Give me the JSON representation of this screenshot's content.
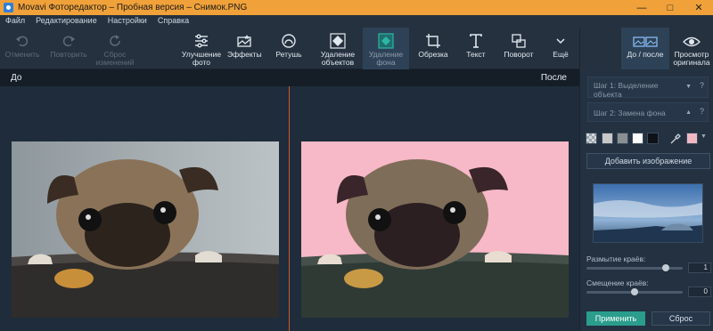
{
  "window": {
    "title": "Movavi Фоторедактор – Пробная версия – Снимок.PNG"
  },
  "menu": [
    "Файл",
    "Редактирование",
    "Настройки",
    "Справка"
  ],
  "toolbar": {
    "undo": "Отменить",
    "redo": "Повторить",
    "reset_changes": "Сброс изменений",
    "enhance": "Улучшение фото",
    "effects": "Эффекты",
    "retouch": "Ретушь",
    "remove_objects": "Удаление объектов",
    "remove_background": "Удаление фона",
    "crop": "Обрезка",
    "text": "Текст",
    "rotate": "Поворот",
    "more": "Ещё"
  },
  "view": {
    "before_after": "До / после",
    "view_original": "Просмотр оригинала"
  },
  "compare": {
    "before": "До",
    "after": "После"
  },
  "panel": {
    "step1": "Шаг 1: Выделение объекта",
    "step2": "Шаг 2: Замена фона",
    "help": "?",
    "add_image": "Добавить изображение",
    "edge_blur_label": "Размытие краёв:",
    "edge_blur_value": "1",
    "edge_blur_level": 0.85,
    "edge_shift_label": "Смещение краёв:",
    "edge_shift_value": "0",
    "edge_shift_level": 0.5,
    "apply": "Применить",
    "reset": "Сброс",
    "swatches": [
      "#c8c8c8",
      "#8a8f94",
      "#ffffff",
      "#0e1217"
    ],
    "selected_color": "#f0b8c4"
  },
  "colors": {
    "titlebar": "#f0a13a",
    "accent": "#2a9d8c",
    "divider": "#d0572b"
  }
}
